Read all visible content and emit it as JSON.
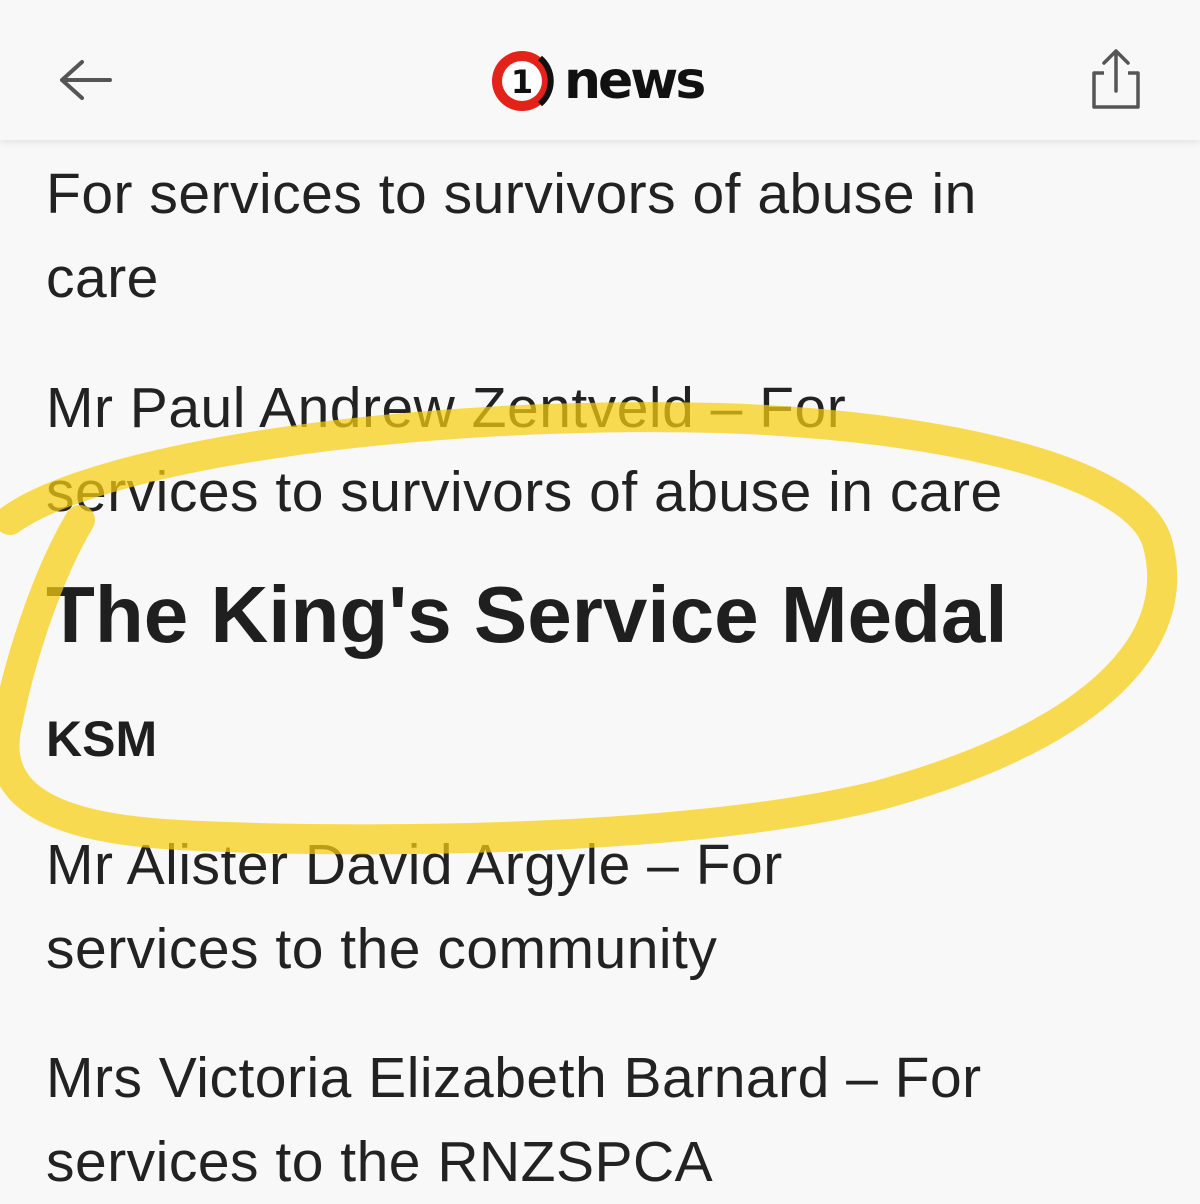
{
  "header": {
    "back_icon": "arrow-left-icon",
    "logo_numeral": "1",
    "logo_word": "news",
    "share_icon": "share-icon",
    "logo_color": "#e32219"
  },
  "article": {
    "para1_line1": "For services to survivors of abuse in",
    "para1_line2": "care",
    "para2_line1": "Mr Paul Andrew Zentveld – For",
    "para2_line2": "services to survivors of abuse in care",
    "heading": "The King's Service Medal",
    "subheading": "KSM",
    "para3_line1": "Mr Alister David Argyle – For",
    "para3_line2": "services to the community",
    "para4_line1": "Mrs Victoria Elizabeth Barnard – For",
    "para4_line2": "services to the RNZSPCA"
  },
  "annotation": {
    "highlight_color": "#f8cf10"
  }
}
